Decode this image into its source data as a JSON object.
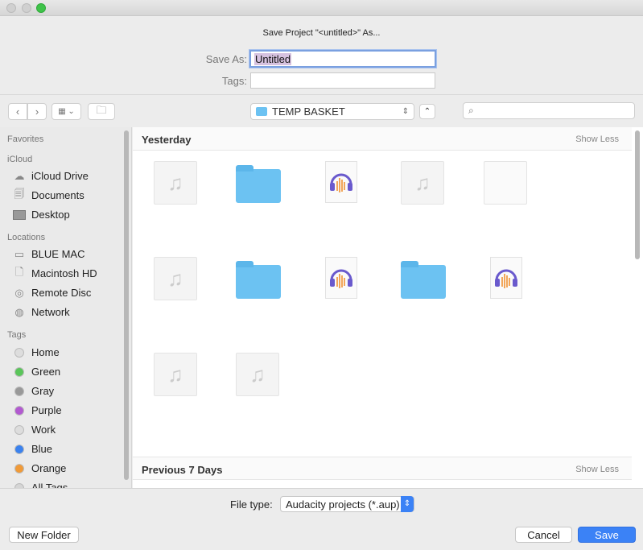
{
  "window": {
    "title": "Save Project \"<untitled>\" As..."
  },
  "form": {
    "save_as_label": "Save As:",
    "save_as_value": "Untitled",
    "tags_label": "Tags:",
    "tags_value": ""
  },
  "toolbar": {
    "location": "TEMP BASKET"
  },
  "sidebar": {
    "favorites": "Favorites",
    "icloud": {
      "header": "iCloud",
      "items": [
        {
          "label": "iCloud Drive",
          "icon": "cloud-icon"
        },
        {
          "label": "Documents",
          "icon": "documents-icon"
        },
        {
          "label": "Desktop",
          "icon": "desktop-icon"
        }
      ]
    },
    "locations": {
      "header": "Locations",
      "items": [
        {
          "label": "BLUE MAC",
          "icon": "laptop-icon"
        },
        {
          "label": "Macintosh HD",
          "icon": "drive-icon"
        },
        {
          "label": "Remote Disc",
          "icon": "disc-icon"
        },
        {
          "label": "Network",
          "icon": "network-icon"
        }
      ]
    },
    "tags": {
      "header": "Tags",
      "items": [
        {
          "label": "Home",
          "color": "#dddddd"
        },
        {
          "label": "Green",
          "color": "#5ac55a"
        },
        {
          "label": "Gray",
          "color": "#999999"
        },
        {
          "label": "Purple",
          "color": "#b25ad0"
        },
        {
          "label": "Work",
          "color": "#dddddd"
        },
        {
          "label": "Blue",
          "color": "#3b82ee"
        },
        {
          "label": "Orange",
          "color": "#f09a38"
        },
        {
          "label": "All Tags",
          "color": "#d5d5d5"
        }
      ]
    }
  },
  "main": {
    "groups": [
      {
        "title": "Yesterday",
        "toggle": "Show Less"
      },
      {
        "title": "Previous 7 Days",
        "toggle": "Show Less"
      }
    ],
    "files": [
      "music",
      "folder",
      "audacity",
      "music",
      "document",
      "music",
      "folder",
      "audacity",
      "folder",
      "audacity",
      "music",
      "music"
    ]
  },
  "footer": {
    "file_type_label": "File type:",
    "file_type_value": "Audacity projects (*.aup)",
    "new_folder": "New Folder",
    "cancel": "Cancel",
    "save": "Save"
  },
  "colors": {
    "accent": "#3b82f6",
    "folder": "#6cc2f2"
  }
}
